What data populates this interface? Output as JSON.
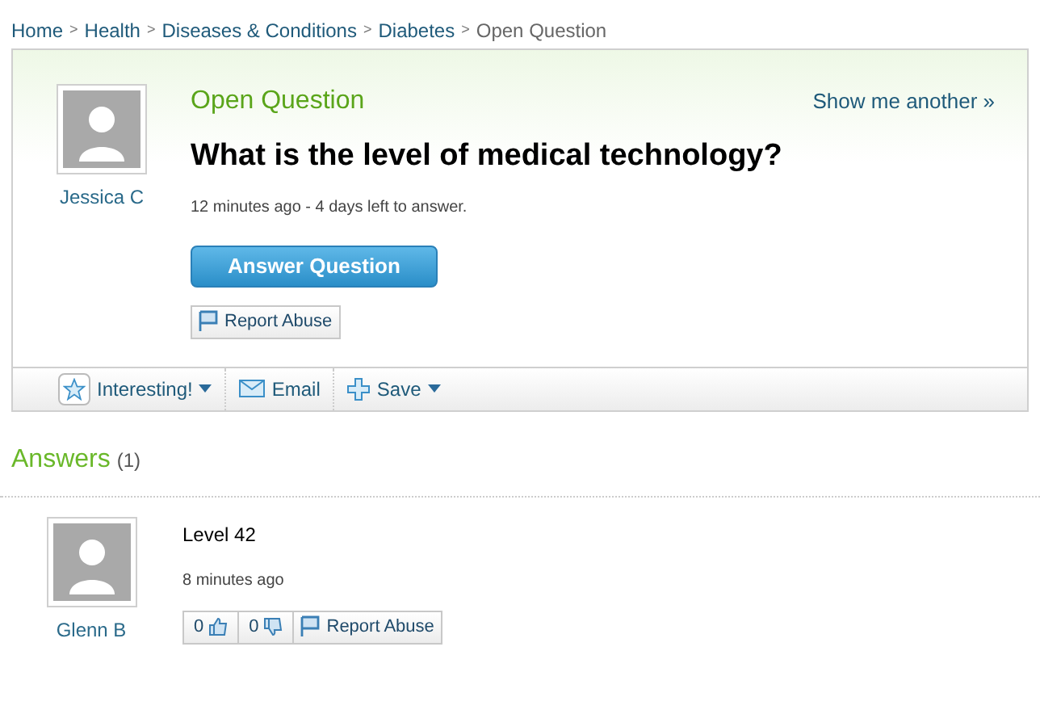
{
  "breadcrumb": {
    "separator": ">",
    "items": [
      {
        "label": "Home",
        "selected": false
      },
      {
        "label": "Health",
        "selected": false
      },
      {
        "label": "Diseases & Conditions",
        "selected": false
      },
      {
        "label": "Diabetes",
        "selected": false
      },
      {
        "label": "Open Question",
        "selected": true
      }
    ]
  },
  "question": {
    "status": "Open Question",
    "show_another": "Show me another »",
    "title": "What is the level of medical technology?",
    "meta": "12 minutes ago - 4 days left to answer.",
    "asker": "Jessica C",
    "answer_button": "Answer Question",
    "report": "Report Abuse"
  },
  "toolbar": [
    {
      "kind": "star",
      "label": "Interesting!",
      "dropdown": true
    },
    {
      "kind": "email",
      "label": "Email",
      "dropdown": false
    },
    {
      "kind": "plus",
      "label": "Save",
      "dropdown": true
    }
  ],
  "answers": {
    "heading": "Answers",
    "count": "(1)",
    "items": [
      {
        "author": "Glenn B",
        "text": "Level 42",
        "meta": "8 minutes ago",
        "thumbs_up": "0",
        "thumbs_down": "0",
        "report": "Report Abuse"
      }
    ]
  }
}
